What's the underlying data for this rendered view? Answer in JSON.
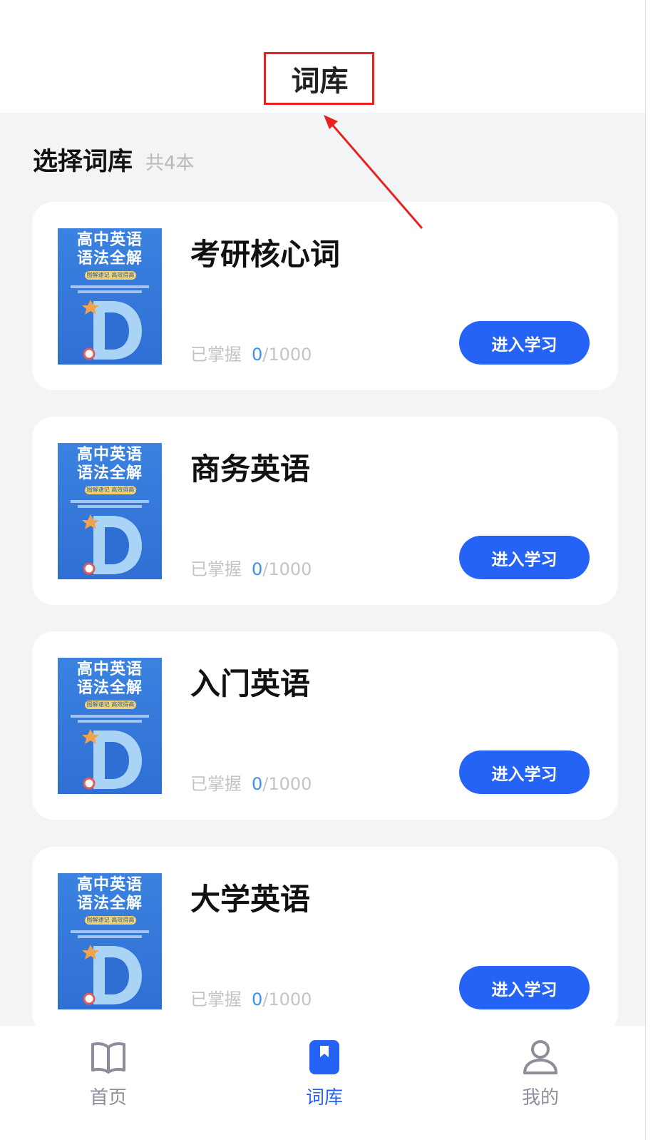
{
  "header": {
    "title": "词库"
  },
  "section": {
    "title": "选择词库",
    "count": "共4本"
  },
  "cover": {
    "line1": "高中英语",
    "line2": "语法全解",
    "tag": "图解速记 高效得高分"
  },
  "books": [
    {
      "title": "考研核心词",
      "progress_label": "已掌握",
      "learned": "0",
      "total": "/1000",
      "button": "进入学习"
    },
    {
      "title": "商务英语",
      "progress_label": "已掌握",
      "learned": "0",
      "total": "/1000",
      "button": "进入学习"
    },
    {
      "title": "入门英语",
      "progress_label": "已掌握",
      "learned": "0",
      "total": "/1000",
      "button": "进入学习"
    },
    {
      "title": "大学英语",
      "progress_label": "已掌握",
      "learned": "0",
      "total": "/1000",
      "button": "进入学习"
    }
  ],
  "tabbar": {
    "items": [
      {
        "label": "首页",
        "icon": "book-open-icon",
        "active": false
      },
      {
        "label": "词库",
        "icon": "bookmark-icon",
        "active": true
      },
      {
        "label": "我的",
        "icon": "user-icon",
        "active": false
      }
    ]
  },
  "colors": {
    "accent": "#2563f6",
    "learned": "#3d8ff0",
    "annotation": "#e8231f"
  }
}
